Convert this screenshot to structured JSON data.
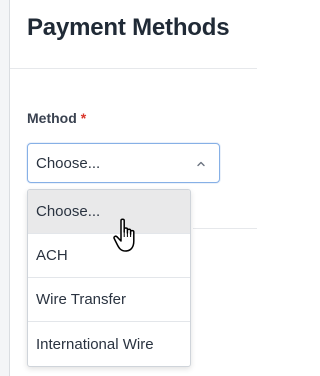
{
  "header": {
    "title": "Payment Methods"
  },
  "form": {
    "method_label": "Method",
    "required_marker": "*",
    "select_value": "Choose..."
  },
  "dropdown": {
    "options": [
      "Choose...",
      "ACH",
      "Wire Transfer",
      "International Wire"
    ],
    "highlighted_index": 0
  },
  "icons": {
    "select_indicator": "chevron-up-icon",
    "cursor": "hand-pointer-cursor-icon"
  },
  "colors": {
    "title": "#202a36",
    "required": "#d9362b",
    "focus_border": "#86b0e6",
    "highlight": "#e9e9ea"
  }
}
